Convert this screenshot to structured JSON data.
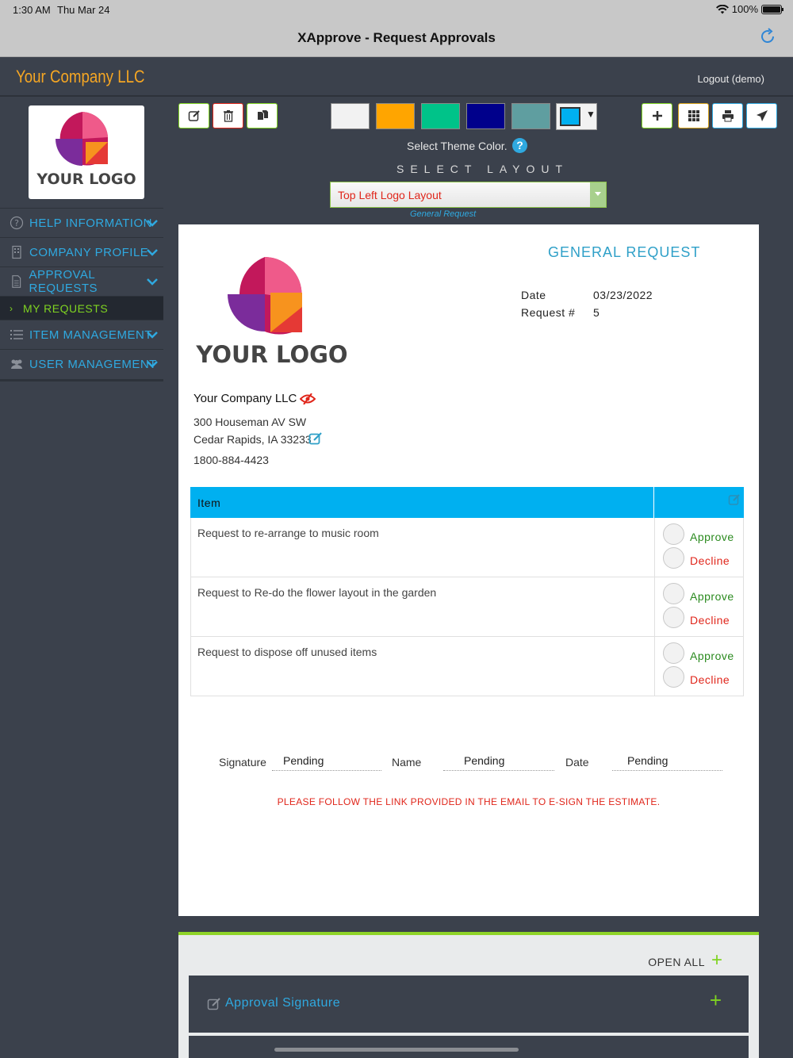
{
  "statusbar": {
    "time": "1:30 AM",
    "date": "Thu Mar 24",
    "battery": "100%"
  },
  "navbar": {
    "title": "XApprove - Request Approvals"
  },
  "header": {
    "company": "Your Company LLC",
    "logout": "Logout (demo)"
  },
  "logo": {
    "text": "YOUR LOGO"
  },
  "sidebar": {
    "items": [
      {
        "label": "HELP INFORMATION"
      },
      {
        "label": "COMPANY PROFILE"
      },
      {
        "label": "APPROVAL REQUESTS"
      },
      {
        "label": "MY REQUESTS"
      },
      {
        "label": "ITEM MANAGEMENT"
      },
      {
        "label": "USER MANAGEMENT"
      }
    ]
  },
  "theme": {
    "label": "Select Theme Color.",
    "help": "?",
    "swatches": [
      "#f2f2f2",
      "#ffa500",
      "#00c389",
      "#00008b",
      "#5f9ea0"
    ],
    "selected": "#00b0f0"
  },
  "layout": {
    "label": "SELECT LAYOUT",
    "value": "Top Left Logo Layout",
    "sublabel": "General Request"
  },
  "document": {
    "title": "GENERAL REQUEST",
    "date_label": "Date",
    "date_value": "03/23/2022",
    "request_label": "Request #",
    "request_value": "5",
    "company": "Your Company LLC",
    "address1": "300 Houseman AV SW",
    "address2": "Cedar Rapids, IA 33233",
    "phone": "1800-884-4423",
    "table_header": "Item",
    "items": [
      {
        "desc": "Request to re-arrange to music room",
        "approve": "Approve",
        "decline": "Decline"
      },
      {
        "desc": "Request to Re-do the flower layout in the garden",
        "approve": "Approve",
        "decline": "Decline"
      },
      {
        "desc": "Request to dispose off unused items",
        "approve": "Approve",
        "decline": "Decline"
      }
    ],
    "signature_label": "Signature",
    "signature_value": "Pending",
    "name_label": "Name",
    "name_value": "Pending",
    "sig_date_label": "Date",
    "sig_date_value": "Pending",
    "notice": "PLEASE FOLLOW THE LINK PROVIDED IN THE EMAIL TO E-SIGN THE ESTIMATE."
  },
  "accordion": {
    "open_all": "OPEN ALL",
    "items": [
      {
        "label": "Approval Signature"
      }
    ]
  },
  "colors": {
    "accent": "#2fa9e0",
    "brand_orange": "#f5a623",
    "green": "#7fd321",
    "red": "#e0261b",
    "table_head": "#00b0f0"
  }
}
